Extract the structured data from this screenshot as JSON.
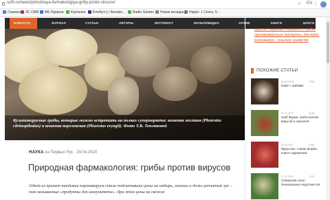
{
  "browser": {
    "url": "scfh.ru/news/prirodnaya-farmakologiya-griby-protiv-virusov/",
    "actions": [
      "☆",
      "EN",
      "⋮"
    ],
    "bookmarks": [
      {
        "label": "Сервисы",
        "color": "#4a7fd0"
      },
      {
        "label": "ЗС СМИ",
        "color": "#c8312d"
      },
      {
        "label": "ФБ Украина",
        "color": "#2f7ae5"
      },
      {
        "label": "Картинки",
        "color": "#4caf50"
      },
      {
        "label": "Блобусту | Кинемо...",
        "color": "#2c3e8f"
      },
      {
        "label": "Radio Garden",
        "color": "#4caf50"
      },
      {
        "label": "Новая вкладка",
        "color": "#888888"
      },
      {
        "label": "Нарко: 1 Сезон, 5...",
        "color": "#777777"
      }
    ]
  },
  "nav": {
    "items": [
      "Новости",
      "Журнал",
      "Статьи",
      "Авторы",
      "Фотолист",
      "Мультимедиа",
      "Архив",
      "Книги",
      "Блоги"
    ]
  },
  "hero": {
    "caption": "Культивируемые грибы, которые можно встретить на полках супермаркета: вешенка желтая (Pleurotus citrinopileatus) и вешенка королевская (Pleurotus eryngii). Фото Т.В. Тепляковой"
  },
  "article": {
    "category": "НАУКА",
    "byline": "из Первых Рук · 29.04.2020",
    "title": "Природная фармакология: грибы против вирусов",
    "lead": "Одной из примет пандемии коронавируса стали подскочившие цены на имбирь, лимоны и даже репчатый лук – так называемые «продукты для иммунитета». При этом цены на свежие"
  },
  "sidebar": {
    "tags": "вирусы, пандемия, иммунитет, грибы, противовирусные препараты, бактерии, коронавирус, сельское хозяйство",
    "similar_heading": "ПОХОЖИЕ СТАТЬИ",
    "similar": [
      {
        "date": "24.04.2019",
        "views": "1236",
        "title": "Кофе с грибами",
        "color": "#3b2a20"
      },
      {
        "date": "01.12.2017",
        "views": "1148",
        "title": "Гриб Фурма: грибы против вирусов и опухолей",
        "color": "#6d7c3f"
      },
      {
        "date": "02.06.2017",
        "views": "2348",
        "title": "Вирусоны: старая форма, новое содержание",
        "color": "#a02b2b"
      },
      {
        "date": "01.12.2017",
        "views": "1128",
        "title": "Сибирский олеат безнаказанно-окуртонистов",
        "color": "#4c7a3a"
      }
    ]
  }
}
